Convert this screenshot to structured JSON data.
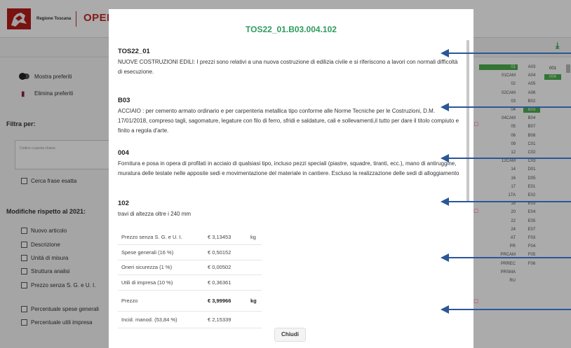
{
  "header": {
    "region": "Regione Toscana",
    "brand": "OPEN"
  },
  "sidebar": {
    "show_favorites": "Mostra preferiti",
    "delete_favorites": "Elimina preferiti",
    "filter_title": "Filtra per:",
    "search_placeholder": "Codice o parola chiave",
    "exact_phrase": "Cerca frase esatta",
    "changes_title": "Modifiche rispetto al 2021:",
    "changes": [
      "Nuovo articolo",
      "Descrizione",
      "Unità di misura",
      "Struttura analisi",
      "Prezzo senza S. G. e U. I.",
      "Percentuale spese generali",
      "Percentuale utili impresa"
    ]
  },
  "modal": {
    "title": "TOS22_01.B03.004.102",
    "sections": [
      {
        "code": "TOS22_01",
        "text": "NUOVE COSTRUZIONI EDILI: I prezzi sono relativi a una nuova costruzione di edilizia civile e si riferiscono a lavori con normali difficoltà di esecuzione."
      },
      {
        "code": "B03",
        "text": "ACCIAIO : per cemento armato ordinario e per carpenteria metallica tipo conforme alle Norme Tecniche per le Costruzioni, D.M. 17/01/2018, compreso tagli, sagomature, legature con filo di ferro, sfridi e saldature, cali e sollevamenti,il tutto per dare il titolo compiuto e finito a regola d'arte."
      },
      {
        "code": "004",
        "text": "Fornitura e posa in opera di profilati in acciaio di qualsiasi tipo, incluso pezzi speciali (piastre, squadre, tiranti, ecc.), mano di antiruggine, muratura delle testate nelle apposite sedi e movimentazione del materiale in cantiere. Escluso la realizzazione delle sedi di alloggiamento"
      },
      {
        "code": "102",
        "text": "travi di altezza oltre i 240 mm"
      }
    ],
    "prices": [
      {
        "name": "Prezzo senza S. G. e U. I.",
        "value": "€ 3,13453",
        "unit": "kg"
      },
      {
        "name": "Spese generali (16 %)",
        "value": "€ 0,50152",
        "unit": ""
      },
      {
        "name": "Oneri sicurezza (1 %)",
        "value": "€ 0,00502",
        "unit": ""
      },
      {
        "name": "Utili di impresa (10 %)",
        "value": "€ 0,36361",
        "unit": ""
      },
      {
        "name": "Prezzo",
        "value": "€ 3,99966",
        "unit": "kg"
      },
      {
        "name": "Incid. manod. (53,84 %)",
        "value": "€ 2,15339",
        "unit": ""
      }
    ],
    "close_label": "Chiudi"
  },
  "codes": {
    "col1": [
      "01",
      "01CAM",
      "02",
      "02CAM",
      "03",
      "04",
      "04CAM",
      "05",
      "06",
      "09",
      "12",
      "12CAM",
      "14",
      "16",
      "17",
      "17A",
      "18",
      "20",
      "22",
      "24",
      "AT",
      "PR",
      "PRCAM",
      "PRREC",
      "PRSMA",
      "RU"
    ],
    "col2": [
      "A03",
      "A04",
      "A05",
      "A06",
      "B02",
      "B03",
      "B04",
      "B07",
      "B08",
      "C01",
      "C02",
      "C03",
      "D01",
      "D05",
      "E01",
      "E02",
      "E03",
      "E04",
      "E05",
      "E07",
      "F03",
      "F04",
      "F05",
      "F06"
    ],
    "col3": [
      "001",
      "004"
    ]
  },
  "colors": {
    "accent": "#2e9b5d",
    "brand": "#c62828",
    "arrow": "#2b5797"
  }
}
